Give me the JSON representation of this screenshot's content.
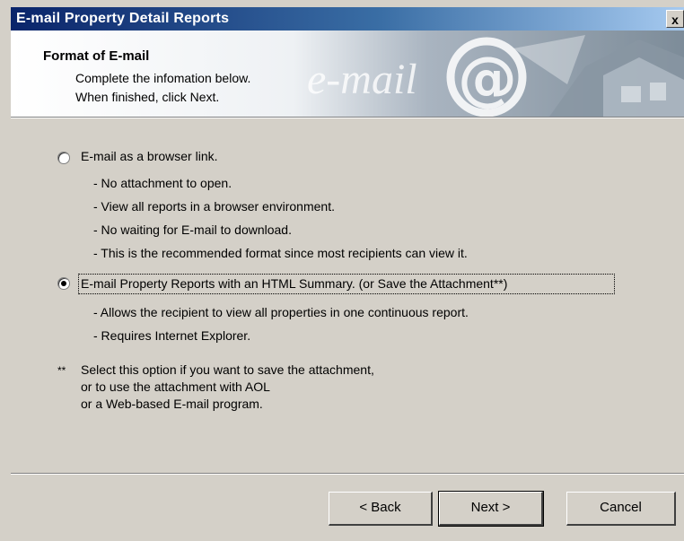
{
  "window": {
    "title": "E-mail Property Detail Reports",
    "close_glyph": "x"
  },
  "header": {
    "title": "Format of E-mail",
    "line1": "Complete the infomation below.",
    "line2": "When finished, click Next.",
    "banner_text": "e-mail",
    "banner_at": "@"
  },
  "options": [
    {
      "label": "E-mail as a browser link.",
      "selected": false,
      "bullets": [
        "- No attachment to open.",
        "- View all reports in a browser environment.",
        "- No waiting for E-mail to download.",
        "- This is the recommended format since most recipients can view it."
      ]
    },
    {
      "label": "E-mail Property Reports with an HTML Summary. (or Save the Attachment**)",
      "selected": true,
      "bullets": [
        "- Allows the recipient to view all properties in one continuous report.",
        "- Requires Internet Explorer."
      ]
    }
  ],
  "note": {
    "mark": "**",
    "lines": [
      "Select this option if you want to save the attachment,",
      "or to use the attachment with AOL",
      "or a Web-based E-mail program."
    ]
  },
  "buttons": {
    "back": "< Back",
    "next": "Next >",
    "cancel": "Cancel"
  },
  "colors": {
    "titlebar_start": "#0a246a",
    "titlebar_end": "#a6caf0",
    "dialog_bg": "#d4d0c8"
  }
}
